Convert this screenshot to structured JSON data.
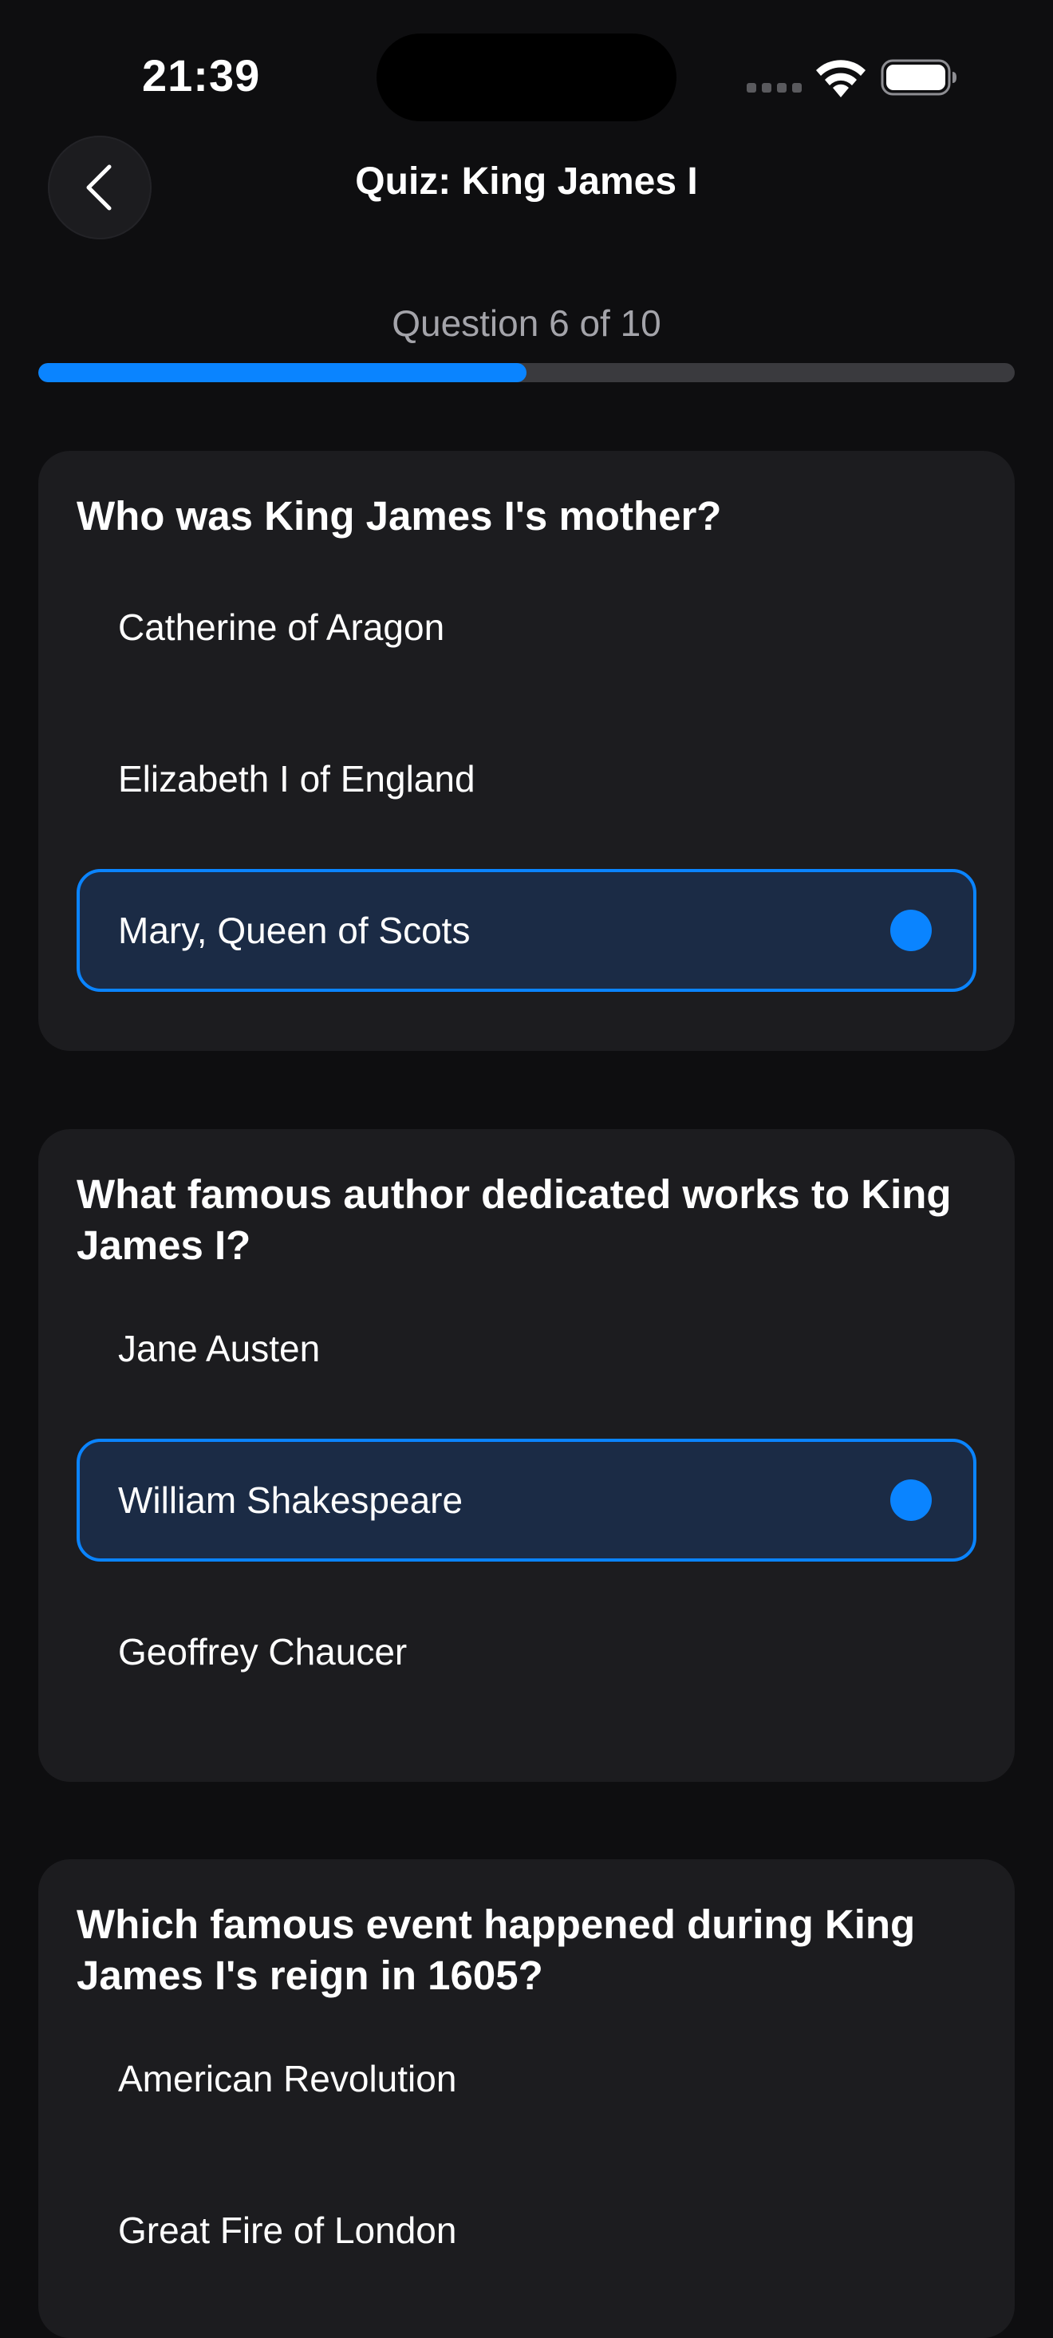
{
  "status_bar": {
    "time": "21:39"
  },
  "icons": {
    "back": "chevron-left-icon",
    "wifi": "wifi-icon",
    "battery": "battery-icon",
    "cellular": "cellular-signal-icon"
  },
  "colors": {
    "accent": "#0a84ff",
    "background": "#0e0e10",
    "card": "#1c1c1f",
    "selected_fill": "#1b2b45"
  },
  "header": {
    "title": "Quiz: King James I"
  },
  "progress": {
    "label": "Question 6 of 10",
    "current": 6,
    "total": 10,
    "fraction": 0.5
  },
  "questions": [
    {
      "text": "Who was King James I's mother?",
      "options": [
        "Catherine of Aragon",
        "Elizabeth I of England",
        "Mary, Queen of Scots"
      ],
      "selected_option": "Mary, Queen of Scots"
    },
    {
      "text": "What famous author dedicated works to King James I?",
      "options": [
        "Jane Austen",
        "William Shakespeare",
        "Geoffrey Chaucer"
      ],
      "selected_option": "William Shakespeare"
    },
    {
      "text": "Which famous event happened during King James I's reign in 1605?",
      "options": [
        "American Revolution",
        "Great Fire of London"
      ],
      "selected_option": null
    }
  ]
}
